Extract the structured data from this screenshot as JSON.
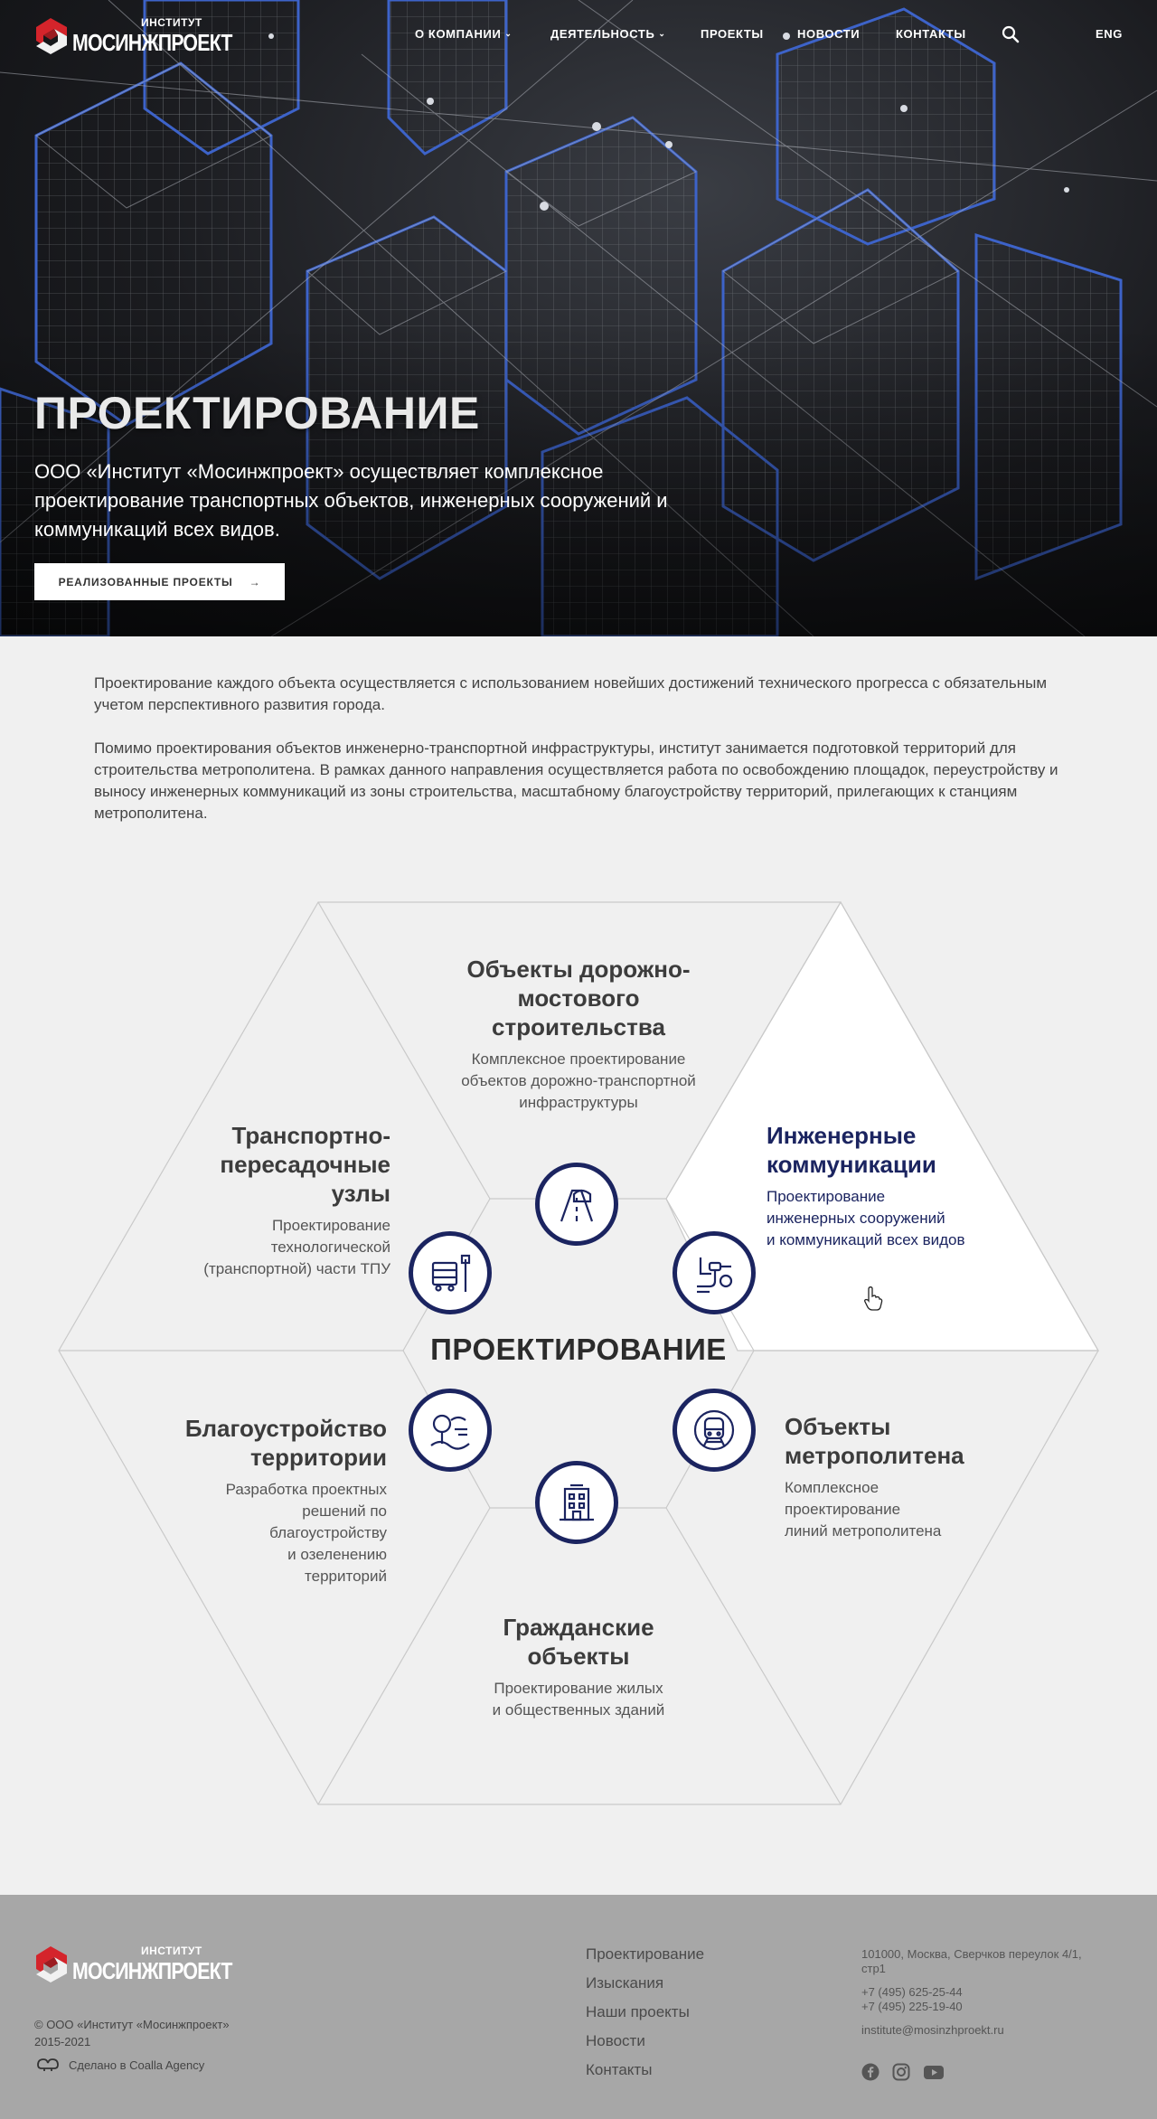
{
  "header": {
    "logo_top": "ИНСТИТУТ",
    "logo_bottom": "МОСИНЖПРОЕКТ",
    "nav": [
      {
        "label": "О КОМПАНИИ",
        "dropdown": true
      },
      {
        "label": "ДЕЯТЕЛЬНОСТЬ",
        "dropdown": true
      },
      {
        "label": "ПРОЕКТЫ",
        "dropdown": false
      },
      {
        "label": "НОВОСТИ",
        "dropdown": false
      },
      {
        "label": "КОНТАКТЫ",
        "dropdown": false
      }
    ],
    "search_icon": "search-icon",
    "lang": "ENG"
  },
  "hero": {
    "title": "ПРОЕКТИРОВАНИЕ",
    "text": "ООО «Институт «Мосинжпроект» осуществляет комплексное проектирование транспортных объектов, инженерных сооружений и коммуникаций всех видов.",
    "button": "РЕАЛИЗОВАННЫЕ ПРОЕКТЫ"
  },
  "intro": {
    "p1": "Проектирование каждого объекта осуществляется с использованием новейших достижений технического прогресса с обязательным учетом перспективного развития города.",
    "p2": "Помимо проектирования объектов инженерно-транспортной инфраструктуры, институт занимается подготовкой территорий для строительства метрополитена. В рамках данного направления осуществляется работа по освобождению площадок, переустройству и выносу инженерных коммуникаций из зоны строительства, масштабному благоустройству территорий, прилегающих к станциям метрополитена."
  },
  "diagram": {
    "center": "ПРОЕКТИРОВАНИЕ",
    "accent_color": "#1b2460",
    "segments": {
      "road": {
        "title": [
          "Объекты дорожно-",
          "мостового",
          "строительства"
        ],
        "desc": [
          "Комплексное проектирование",
          "объектов дорожно-транспортной",
          "инфраструктуры"
        ],
        "icon": "road-bridge-icon"
      },
      "tpu": {
        "title": [
          "Транспортно-",
          "пересадочные",
          "узлы"
        ],
        "desc": [
          "Проектирование",
          "технологической",
          "(транспортной) части ТПУ"
        ],
        "icon": "bus-stop-icon"
      },
      "utilities": {
        "title": [
          "Инженерные",
          "коммуникации"
        ],
        "desc": [
          "Проектирование",
          "инженерных сооружений",
          "и коммуникаций всех видов"
        ],
        "icon": "pipes-icon"
      },
      "landscape": {
        "title": [
          "Благоустройство",
          "территории"
        ],
        "desc": [
          "Разработка проектных",
          "решений по",
          "благоустройству",
          "и озеленению",
          "территорий"
        ],
        "icon": "park-icon"
      },
      "metro": {
        "title": [
          "Объекты",
          "метрополитена"
        ],
        "desc": [
          "Комплексное",
          "проектирование",
          "линий метрополитена"
        ],
        "icon": "metro-train-icon"
      },
      "civil": {
        "title": [
          "Гражданские",
          "объекты"
        ],
        "desc": [
          "Проектирование жилых",
          "и общественных зданий"
        ],
        "icon": "building-icon"
      }
    }
  },
  "footer": {
    "copyright": "© ООО «Институт «Мосинжпроект» 2015-2021",
    "made_by": "Сделано в Coalla Agency",
    "nav": [
      "Проектирование",
      "Изыскания",
      "Наши проекты",
      "Новости",
      "Контакты"
    ],
    "address": "101000, Москва, Сверчков переулок 4/1, стр1",
    "phone1": "+7 (495) 625-25-44",
    "phone2": "+7 (495) 225-19-40",
    "email": "institute@mosinzhproekt.ru",
    "socials": [
      "facebook-icon",
      "instagram-icon",
      "youtube-icon"
    ]
  }
}
